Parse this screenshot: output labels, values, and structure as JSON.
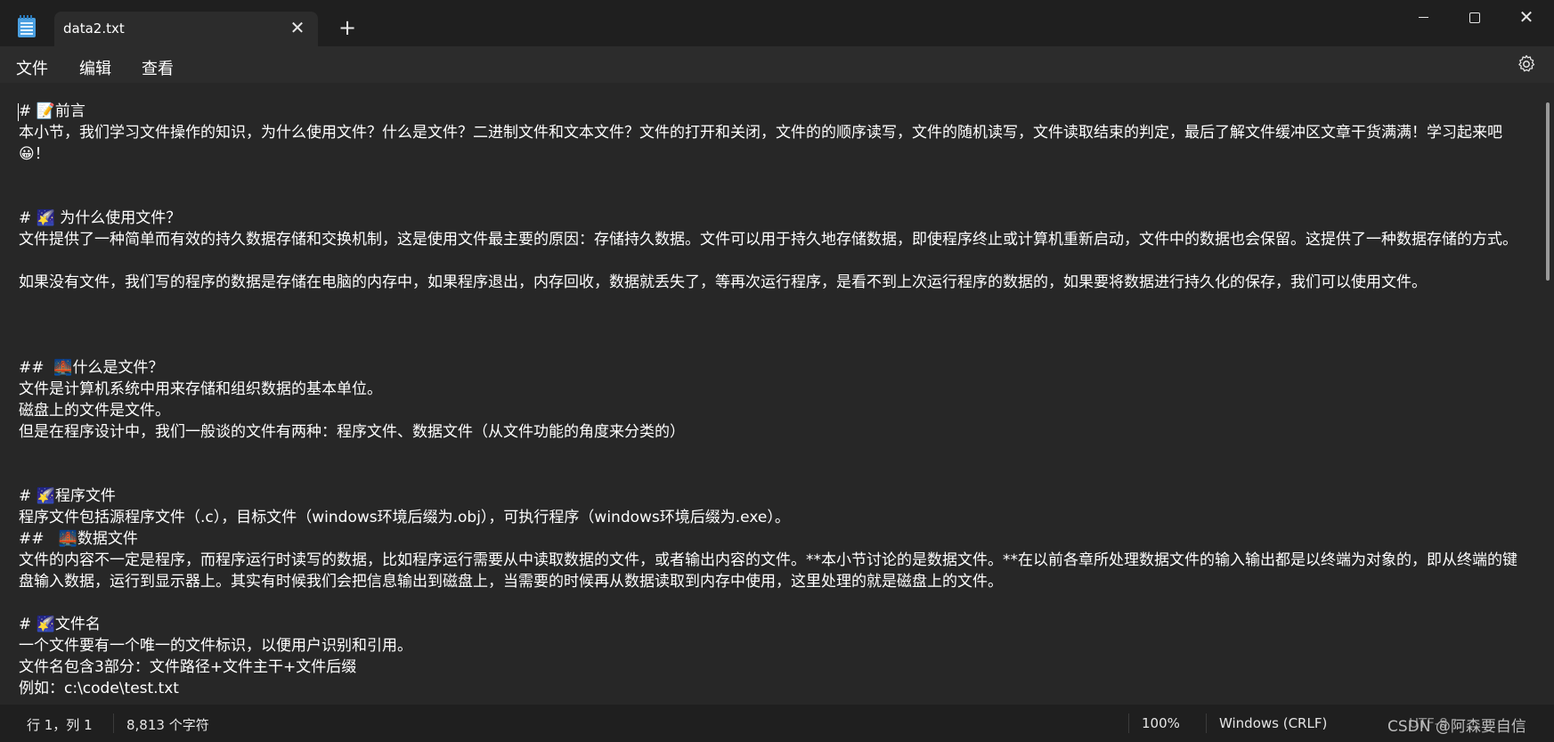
{
  "window": {
    "tab_title": "data2.txt",
    "tab_close_glyph": "✕",
    "new_tab_glyph": "+",
    "minimize_label": "",
    "close_glyph": "✕"
  },
  "menu": {
    "file": "文件",
    "edit": "编辑",
    "view": "查看"
  },
  "icons": {
    "app": "notepad-icon",
    "settings": "gear-icon"
  },
  "editor": {
    "lines": [
      "# 📝前言",
      "本小节，我们学习文件操作的知识，为什么使用文件？什么是文件？二进制文件和文本文件？文件的打开和关闭，文件的的顺序读写，文件的随机读写，文件读取结束的判定，最后了解文件缓冲区文章干货满满！学习起来吧😀！",
      "",
      "",
      "# 🌠 为什么使用文件？",
      "文件提供了一种简单而有效的持久数据存储和交换机制，这是使用文件最主要的原因：存储持久数据。文件可以用于持久地存储数据，即使程序终止或计算机重新启动，文件中的数据也会保留。这提供了一种数据存储的方式。",
      "",
      "如果没有文件，我们写的程序的数据是存储在电脑的内存中，如果程序退出，内存回收，数据就丢失了，等再次运行程序，是看不到上次运行程序的数据的，如果要将数据进行持久化的保存，我们可以使用文件。",
      "",
      "",
      "",
      "##  🌉什么是文件？",
      "文件是计算机系统中用来存储和组织数据的基本单位。",
      "磁盘上的文件是文件。",
      "但是在程序设计中，我们一般谈的文件有两种：程序文件、数据文件（从文件功能的角度来分类的）",
      "",
      "",
      "# 🌠程序文件",
      "程序文件包括源程序文件（.c），目标文件（windows环境后缀为.obj），可执行程序（windows环境后缀为.exe）。",
      "##   🌉数据文件",
      "文件的内容不一定是程序，而程序运行时读写的数据，比如程序运行需要从中读取数据的文件，或者输出内容的文件。**本小节讨论的是数据文件。**在以前各章所处理数据文件的输入输出都是以终端为对象的，即从终端的键盘输入数据，运行到显示器上。其实有时候我们会把信息输出到磁盘上，当需要的时候再从数据读取到内存中使用，这里处理的就是磁盘上的文件。",
      "",
      "# 🌠文件名",
      "一个文件要有一个唯一的文件标识，以便用户识别和引用。",
      "文件名包含3部分：文件路径+文件主干+文件后缀",
      "例如：c:\\code\\test.txt"
    ]
  },
  "status": {
    "position": "行 1，列 1",
    "char_count": "8,813 个字符",
    "zoom": "100%",
    "line_ending": "Windows (CRLF)",
    "encoding": "UTF-8",
    "watermark": "CSDN @阿森要自信"
  }
}
